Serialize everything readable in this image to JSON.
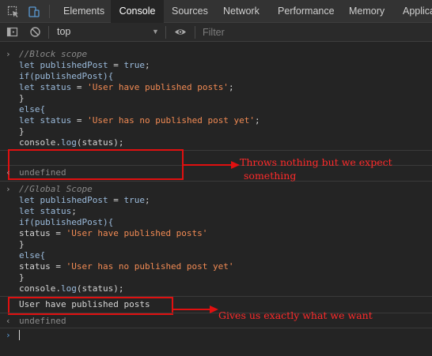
{
  "tabs": {
    "elements": "Elements",
    "console": "Console",
    "sources": "Sources",
    "network": "Network",
    "performance": "Performance",
    "memory": "Memory",
    "application": "Applica"
  },
  "filterbar": {
    "context": "top",
    "filter_placeholder": "Filter"
  },
  "block1": {
    "l1": "//Block scope",
    "l2a": "let",
    "l2b": "publishedPost",
    "l2c": " = ",
    "l2d": "true",
    "l2e": ";",
    "l3": "if(publishedPost){",
    "l4a": "let",
    "l4b": "status",
    "l4c": " = ",
    "l4d": "'User have published posts'",
    "l4e": ";",
    "l5": "}",
    "l6": "else{",
    "l7a": "let",
    "l7b": "status",
    "l7c": " = ",
    "l7d": "'User has no published post yet'",
    "l7e": ";",
    "l8": "}",
    "l9a": "console.",
    "l9b": "log",
    "l9c": "(status);",
    "result": "undefined"
  },
  "block2": {
    "l1": "//Global Scope",
    "l2a": "let",
    "l2b": "publishedPost",
    "l2c": " = ",
    "l2d": "true",
    "l2e": ";",
    "l3a": "let",
    "l3b": "status",
    "l3c": ";",
    "l4": "if(publishedPost){",
    "l5a": "status = ",
    "l5b": "'User have published posts'",
    "l6": "}",
    "l7": "else{",
    "l8a": "status = ",
    "l8b": "'User has no published post yet'",
    "l9": "}",
    "l10a": "console.",
    "l10b": "log",
    "l10c": "(status);",
    "log_output": "User have published posts",
    "result": "undefined"
  },
  "annotations": {
    "a1_line1": "Throws nothing but we expect",
    "a1_line2": "something",
    "a2": "Gives us exactly what we want"
  },
  "colors": {
    "annotation": "#ff2a2a",
    "string": "#f28b54",
    "keyword": "#9bbbdc"
  }
}
